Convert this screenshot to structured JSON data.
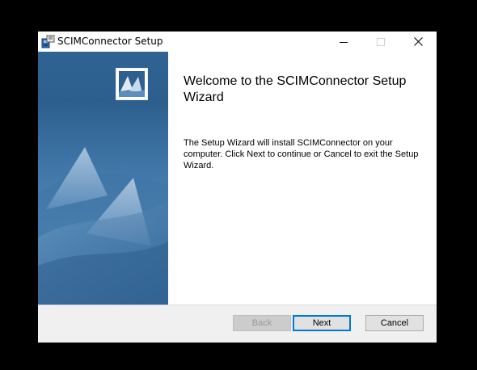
{
  "window": {
    "title": "SCIMConnector Setup",
    "controls": {
      "minimize": "minimize-icon",
      "maximize": "maximize-icon",
      "close": "close-icon"
    }
  },
  "welcome": {
    "title": "Welcome to the SCIMConnector Setup Wizard",
    "body": "The Setup Wizard will install SCIMConnector on your computer. Click Next to continue or Cancel to exit the Setup Wizard."
  },
  "buttons": {
    "back": "Back",
    "next": "Next",
    "cancel": "Cancel"
  },
  "colors": {
    "panel_blue": "#2f6393",
    "focus_border": "#0078d7"
  }
}
